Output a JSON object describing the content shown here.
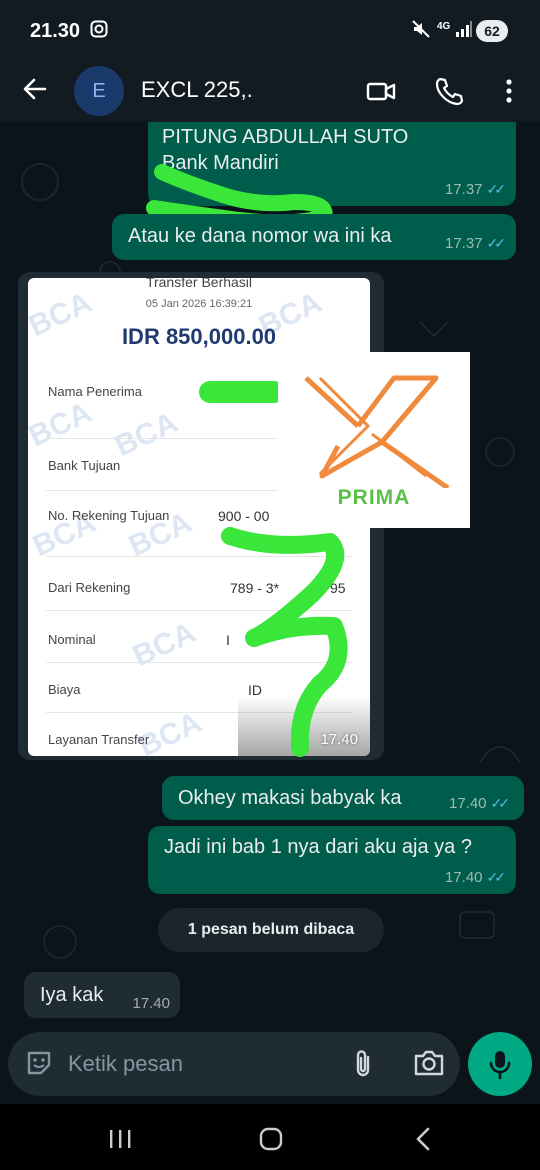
{
  "status_bar": {
    "time": "21.30",
    "network": "4G",
    "battery": "62"
  },
  "header": {
    "avatar_letter": "E",
    "contact_name": "EXCL 225,."
  },
  "messages": [
    {
      "id": "m1",
      "direction": "out",
      "lines": [
        "PITUNG ABDULLAH SUTO",
        "Bank Mandiri"
      ],
      "time": "17.37",
      "status": "read"
    },
    {
      "id": "m2",
      "direction": "out",
      "text": "Atau ke dana nomor wa ini ka",
      "time": "17.37",
      "status": "read"
    },
    {
      "id": "m3",
      "direction": "in",
      "type": "image",
      "time": "17.40"
    },
    {
      "id": "m4",
      "direction": "out",
      "text": "Okhey makasi babyak ka",
      "time": "17.40",
      "status": "read"
    },
    {
      "id": "m5",
      "direction": "out",
      "text": "Jadi ini bab 1 nya dari aku aja ya ?",
      "time": "17.40",
      "status": "read"
    },
    {
      "id": "m6",
      "direction": "in",
      "text": "Iya kak",
      "time": "17.40"
    }
  ],
  "receipt": {
    "heading": "Transfer Berhasil",
    "datetime": "05 Jan 2026 16:39:21",
    "amount": "IDR 850,000.00",
    "watermark": "BCA",
    "rows": [
      {
        "label": "Nama Penerima",
        "value": ""
      },
      {
        "label": "Bank Tujuan",
        "value": ""
      },
      {
        "label": "No. Rekening Tujuan",
        "value": "900 - 00"
      },
      {
        "label": "Dari Rekening",
        "value": "789 - 3*"
      },
      {
        "label": "Nominal",
        "value": "I"
      },
      {
        "label": "Biaya",
        "value": "ID"
      },
      {
        "label": "Layanan Transfer",
        "value": ""
      }
    ]
  },
  "overlay_logo": {
    "word": "PRIMA",
    "letter": "X",
    "accent_color": "#f08a3c",
    "word_color": "#59c148"
  },
  "unread_banner": "1 pesan belum dibaca",
  "composer": {
    "placeholder": "Ketik pesan"
  },
  "colors": {
    "outgoing_bubble": "#005c4b",
    "incoming_bubble": "#202c33",
    "read_ticks": "#53bdeb",
    "mic_button": "#00a884",
    "scribble": "#39e639"
  },
  "icons": {
    "back": "arrow-left-icon",
    "video": "video-camera-icon",
    "call": "phone-icon",
    "menu": "more-vert-icon",
    "sticker": "sticker-icon",
    "attach": "paperclip-icon",
    "camera": "camera-icon",
    "mic": "microphone-icon"
  }
}
